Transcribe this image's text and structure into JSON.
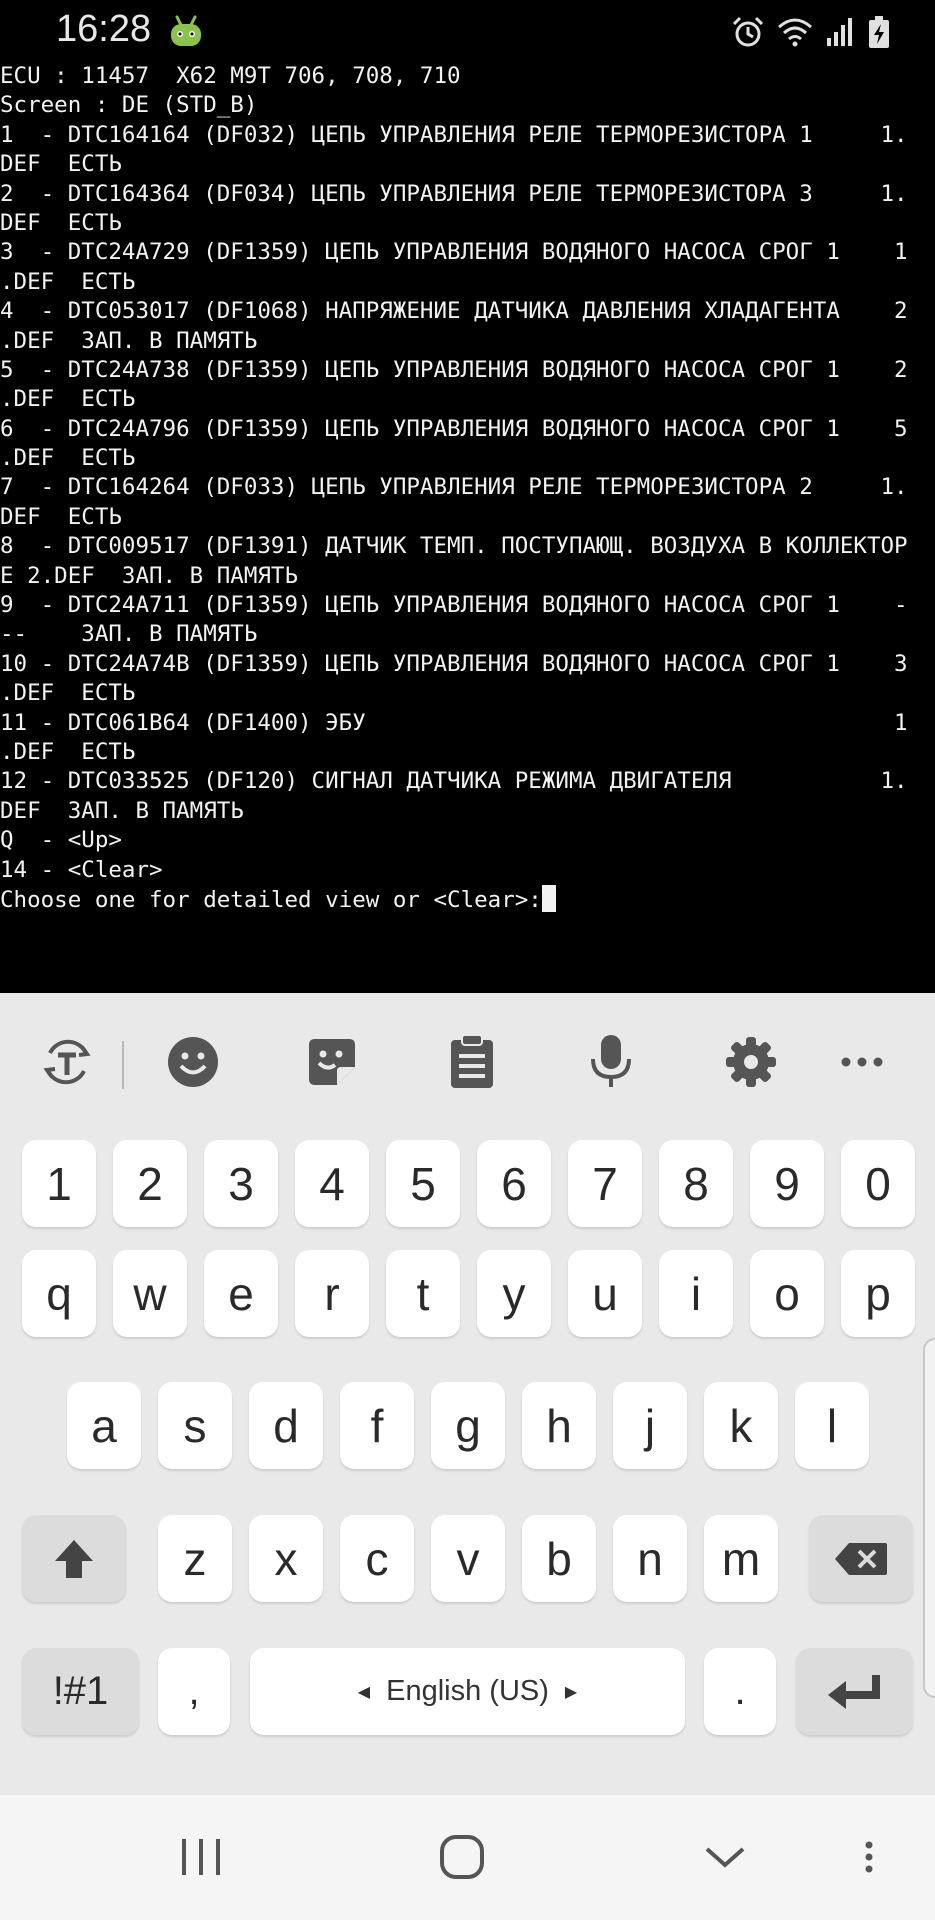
{
  "status_bar": {
    "time": "16:28",
    "icons": [
      "android-icon",
      "alarm-icon",
      "wifi-icon",
      "cell-signal-icon",
      "battery-charging-icon"
    ]
  },
  "terminal": {
    "lines": [
      "ECU : 11457  X62 M9T 706, 708, 710",
      "Screen : DE (STD_B)",
      "1  - DTC164164 (DF032) ЦЕПЬ УПРАВЛЕНИЯ РЕЛЕ ТЕРМОРЕЗИСТОРА 1     1.",
      "DEF  ЕСТЬ",
      "2  - DTC164364 (DF034) ЦЕПЬ УПРАВЛЕНИЯ РЕЛЕ ТЕРМОРЕЗИСТОРА 3     1.",
      "DEF  ЕСТЬ",
      "3  - DTC24A729 (DF1359) ЦЕПЬ УПРАВЛЕНИЯ ВОДЯНОГО НАСОСА СРОГ 1    1",
      ".DEF  ЕСТЬ",
      "4  - DTC053017 (DF1068) НАПРЯЖЕНИЕ ДАТЧИКА ДАВЛЕНИЯ ХЛАДАГЕНТА    2",
      ".DEF  ЗАП. В ПАМЯТЬ",
      "5  - DTC24A738 (DF1359) ЦЕПЬ УПРАВЛЕНИЯ ВОДЯНОГО НАСОСА СРОГ 1    2",
      ".DEF  ЕСТЬ",
      "6  - DTC24A796 (DF1359) ЦЕПЬ УПРАВЛЕНИЯ ВОДЯНОГО НАСОСА СРОГ 1    5",
      ".DEF  ЕСТЬ",
      "7  - DTC164264 (DF033) ЦЕПЬ УПРАВЛЕНИЯ РЕЛЕ ТЕРМОРЕЗИСТОРА 2     1.",
      "DEF  ЕСТЬ",
      "8  - DTC009517 (DF1391) ДАТЧИК ТЕМП. ПОСТУПАЮЩ. ВОЗДУХА В КОЛЛЕКТОР",
      "Е 2.DEF  ЗАП. В ПАМЯТЬ",
      "9  - DTC24A711 (DF1359) ЦЕПЬ УПРАВЛЕНИЯ ВОДЯНОГО НАСОСА СРОГ 1    -",
      "--    ЗАП. В ПАМЯТЬ",
      "10 - DTC24A74B (DF1359) ЦЕПЬ УПРАВЛЕНИЯ ВОДЯНОГО НАСОСА СРОГ 1    3",
      ".DEF  ЕСТЬ",
      "11 - DTC061B64 (DF1400) ЭБУ                                       1",
      ".DEF  ЕСТЬ",
      "12 - DTC033525 (DF120) СИГНАЛ ДАТЧИКА РЕЖИМА ДВИГАТЕЛЯ           1.",
      "DEF  ЗАП. В ПАМЯТЬ",
      "Q  - <Up>",
      "14 - <Clear>"
    ],
    "prompt": "Choose one for detailed view or <Clear>:"
  },
  "keyboard": {
    "toolbar_icons": [
      "translate-icon",
      "emoji-icon",
      "sticker-icon",
      "clipboard-icon",
      "microphone-icon",
      "settings-gear-icon",
      "more-icon"
    ],
    "number_row": [
      "1",
      "2",
      "3",
      "4",
      "5",
      "6",
      "7",
      "8",
      "9",
      "0"
    ],
    "row1": [
      "q",
      "w",
      "e",
      "r",
      "t",
      "y",
      "u",
      "i",
      "o",
      "p"
    ],
    "row2": [
      "a",
      "s",
      "d",
      "f",
      "g",
      "h",
      "j",
      "k",
      "l"
    ],
    "row3": [
      "z",
      "x",
      "c",
      "v",
      "b",
      "n",
      "m"
    ],
    "symbols_label": "!#1",
    "comma_label": ",",
    "space_label": "English (US)",
    "period_label": ".",
    "shift_icon": "shift-arrow-icon",
    "backspace_icon": "backspace-icon",
    "enter_icon": "enter-icon"
  },
  "nav_bar": {
    "icons": [
      "recent-apps-icon",
      "home-icon",
      "back-icon",
      "menu-dots-icon"
    ]
  }
}
